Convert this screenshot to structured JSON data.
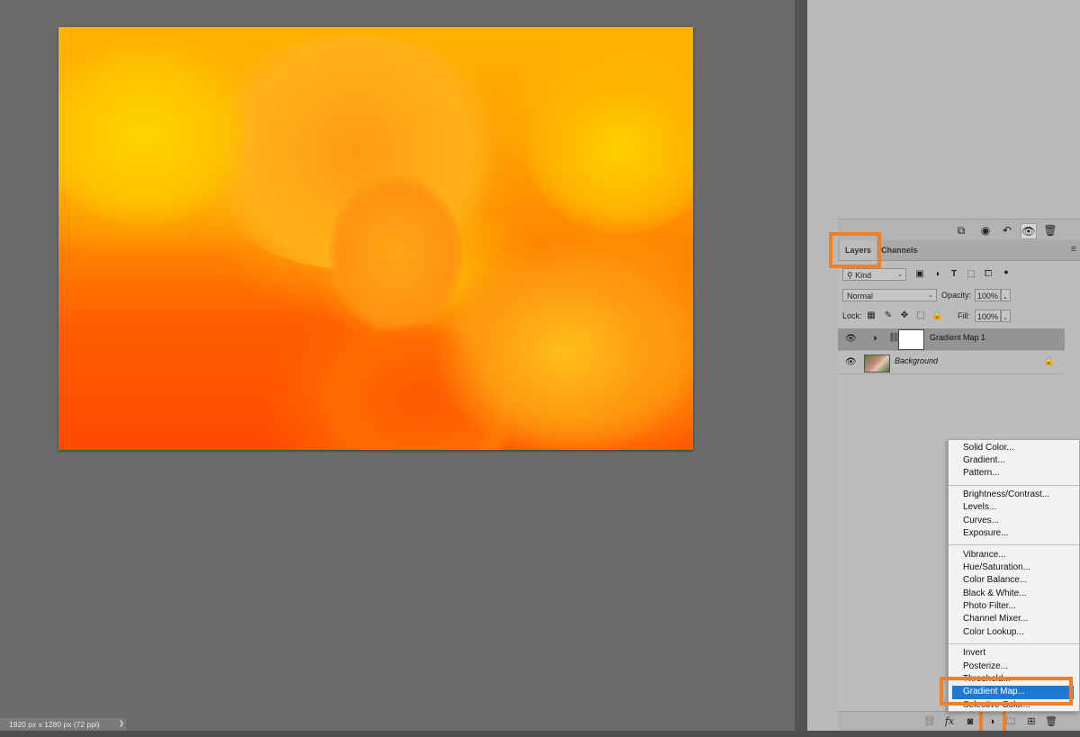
{
  "document": {
    "status_info": "1920 px x 1280 px (72 ppi)",
    "status_arrow": "❯"
  },
  "colors": {
    "highlight": "#f07f28",
    "selected_menu": "#1f78d1",
    "panel_bg": "#bcbcbc",
    "canvas_bg": "#6b6b6b"
  },
  "history_toolbar": {
    "icons": [
      "new-snapshot-icon",
      "visibility-icon",
      "undo-icon",
      "eye-icon",
      "trash-icon"
    ]
  },
  "layers_panel": {
    "tabs": [
      "Layers",
      "Channels"
    ],
    "filter_kind": "Kind",
    "blend_mode": "Normal",
    "opacity_label": "Opacity:",
    "opacity_value": "100%",
    "lock_label": "Lock:",
    "fill_label": "Fill:",
    "fill_value": "100%",
    "layers": [
      {
        "name": "Gradient Map 1",
        "visible": true,
        "selected": true
      },
      {
        "name": "Background",
        "visible": true,
        "locked": true
      }
    ],
    "footer_icons": [
      "link-icon",
      "fx-icon",
      "mask-icon",
      "adjustment-icon",
      "group-icon",
      "new-layer-icon",
      "trash-icon"
    ],
    "fx_label": "fx"
  },
  "adjustment_menu": {
    "group1": [
      "Solid Color...",
      "Gradient...",
      "Pattern..."
    ],
    "group2": [
      "Brightness/Contrast...",
      "Levels...",
      "Curves...",
      "Exposure..."
    ],
    "group3": [
      "Vibrance...",
      "Hue/Saturation...",
      "Color Balance...",
      "Black & White...",
      "Photo Filter...",
      "Channel Mixer...",
      "Color Lookup..."
    ],
    "group4": [
      "Invert",
      "Posterize...",
      "Threshold...",
      "Gradient Map...",
      "Selective Color..."
    ],
    "selected": "Gradient Map..."
  }
}
